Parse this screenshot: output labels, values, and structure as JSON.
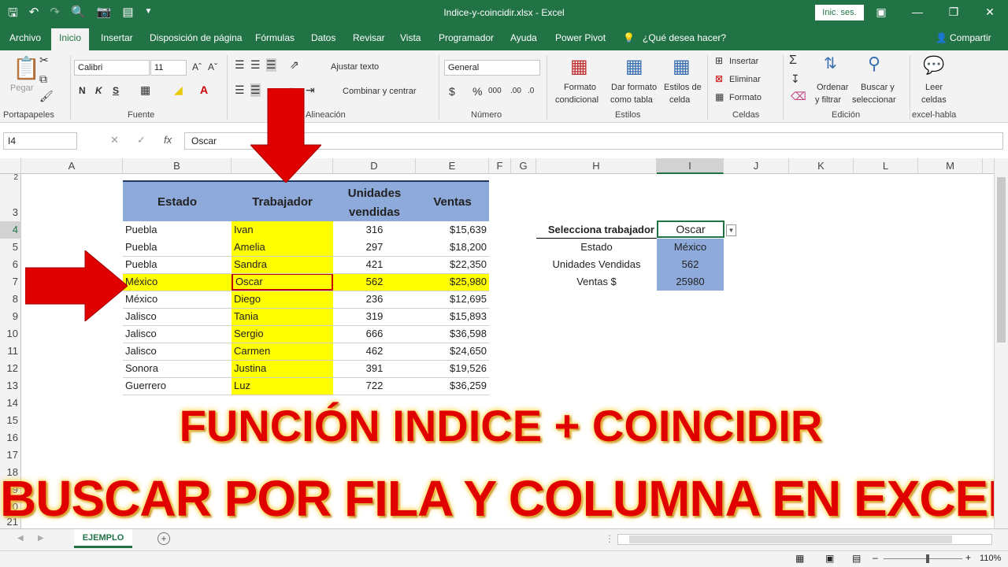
{
  "window": {
    "title": "Indice-y-coincidir.xlsx  -  Excel",
    "signin": "Inic. ses."
  },
  "menu": {
    "tabs": [
      "Archivo",
      "Inicio",
      "Insertar",
      "Disposición de página",
      "Fórmulas",
      "Datos",
      "Revisar",
      "Vista",
      "Programador",
      "Ayuda",
      "Power Pivot"
    ],
    "tell_me": "¿Qué desea hacer?",
    "share": "Compartir"
  },
  "ribbon": {
    "groups": {
      "portapapeles": "Portapapeles",
      "fuente": "Fuente",
      "alineacion": "Alineación",
      "numero": "Número",
      "estilos": "Estilos",
      "celdas": "Celdas",
      "edicion": "Edición",
      "habla": "excel-habla"
    },
    "paste": "Pegar",
    "font_name": "Calibri",
    "font_size": "11",
    "bold": "N",
    "italic": "K",
    "underline": "S",
    "wrap": "Ajustar texto",
    "merge": "Combinar y centrar",
    "number_format": "General",
    "cond_format_1": "Formato",
    "cond_format_2": "condicional",
    "table_format_1": "Dar formato",
    "table_format_2": "como tabla",
    "cell_styles_1": "Estilos de",
    "cell_styles_2": "celda",
    "insert": "Insertar",
    "delete": "Eliminar",
    "format": "Formato",
    "sort_1": "Ordenar",
    "sort_2": "y filtrar",
    "find_1": "Buscar y",
    "find_2": "seleccionar",
    "read_1": "Leer",
    "read_2": "celdas"
  },
  "formula_bar": {
    "name_box": "I4",
    "fx": "fx",
    "value": "Oscar"
  },
  "columns": [
    "A",
    "B",
    "C",
    "D",
    "E",
    "F",
    "G",
    "H",
    "I",
    "J",
    "K",
    "L",
    "M"
  ],
  "rows": [
    "2",
    "3",
    "4",
    "5",
    "6",
    "7",
    "8",
    "9",
    "10",
    "11",
    "12",
    "13",
    "14",
    "15",
    "16",
    "17",
    "18",
    "19",
    "20",
    "21"
  ],
  "table": {
    "headers": [
      "Estado",
      "Trabajador",
      "Unidades vendidas",
      "Ventas"
    ],
    "rows": [
      [
        "Puebla",
        "Ivan",
        "316",
        "$15,639"
      ],
      [
        "Puebla",
        "Amelia",
        "297",
        "$18,200"
      ],
      [
        "Puebla",
        "Sandra",
        "421",
        "$22,350"
      ],
      [
        "México",
        "Oscar",
        "562",
        "$25,980"
      ],
      [
        "México",
        "Diego",
        "236",
        "$12,695"
      ],
      [
        "Jalisco",
        "Tania",
        "319",
        "$15,893"
      ],
      [
        "Jalisco",
        "Sergio",
        "666",
        "$36,598"
      ],
      [
        "Jalisco",
        "Carmen",
        "462",
        "$24,650"
      ],
      [
        "Sonora",
        "Justina",
        "391",
        "$19,526"
      ],
      [
        "Guerrero",
        "Luz",
        "722",
        "$36,259"
      ]
    ]
  },
  "lookup": {
    "select_label": "Selecciona trabajador",
    "select_value": "Oscar",
    "labels": [
      "Estado",
      "Unidades Vendidas",
      "Ventas $"
    ],
    "values": [
      "México",
      "562",
      "25980"
    ]
  },
  "banner": {
    "line1": "FUNCIÓN INDICE + COINCIDIR",
    "line2": "BUSCAR POR FILA Y COLUMNA EN EXCEL"
  },
  "sheet": {
    "tab": "EJEMPLO"
  },
  "status": {
    "zoom": "110%"
  },
  "colors": {
    "excel_green": "#217346",
    "header_blue": "#8eaadb",
    "highlight_yellow": "#ffff00",
    "arrow_red": "#e00000"
  }
}
